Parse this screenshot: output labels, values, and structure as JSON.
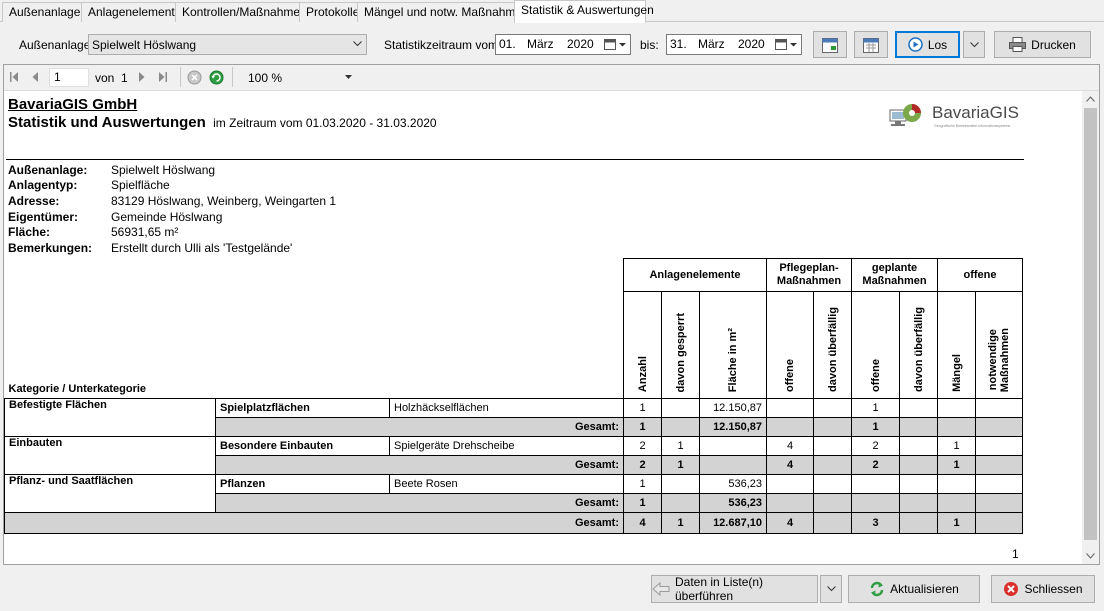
{
  "tabs": [
    "Außenanlagen",
    "Anlagenelemente",
    "Kontrollen/Maßnahmen",
    "Protokolle",
    "Mängel und notw. Maßnahmen",
    "Statistik & Auswertungen"
  ],
  "toolbar": {
    "aussenanlage_label": "Außenanlage:",
    "aussenanlage_value": "Spielwelt Höslwang",
    "zeitraum_label": "Statistikzeitraum vom:",
    "from_day": "01.",
    "from_month": "März",
    "from_year": "2020",
    "bis_label": "bis:",
    "to_day": "31.",
    "to_month": "März",
    "to_year": "2020",
    "los_label": "Los",
    "drucken_label": "Drucken"
  },
  "viewer": {
    "page_value": "1",
    "von_label": "von",
    "page_total": "1",
    "zoom": "100 %",
    "page_number": "1"
  },
  "report": {
    "company": "BavariaGIS GmbH",
    "title": "Statistik und Auswertungen",
    "period": "im Zeitraum vom 01.03.2020 - 31.03.2020",
    "logo_text": "BavariaGIS",
    "logo_sub": "Geografische Betriebsmittel-Informationssysteme",
    "info": [
      {
        "label": "Außenanlage:",
        "value": "Spielwelt Höslwang"
      },
      {
        "label": "Anlagentyp:",
        "value": "Spielfläche"
      },
      {
        "label": "Adresse:",
        "value": "83129 Höslwang, Weinberg, Weingarten 1"
      },
      {
        "label": "Eigentümer:",
        "value": "Gemeinde Höslwang"
      },
      {
        "label": "Fläche:",
        "value": "56931,65 m²"
      },
      {
        "label": "Bemerkungen:",
        "value": "Erstellt durch Ulli als 'Testgelände'"
      }
    ],
    "col_kategorie": "Kategorie / Unterkategorie",
    "groups": {
      "anlagenelemente": "Anlagenelemente",
      "pflegeplan_1": "Pflegeplan-",
      "pflegeplan_2": "Maßnahmen",
      "geplante_1": "geplante",
      "geplante_2": "Maßnahmen",
      "offene": "offene"
    },
    "subheaders": {
      "anzahl": "Anzahl",
      "davon_gesperrt": "davon gesperrt",
      "flaeche": "Fläche in m²",
      "pp_offene": "offene",
      "pp_ueberfaellig": "davon überfällig",
      "gp_offene": "offene",
      "gp_ueberfaellig": "davon überfällig",
      "maengel": "Mängel",
      "notw_1": "notwendige",
      "notw_2": "Maßnahmen"
    },
    "rows": [
      {
        "kategorie": "Befestigte Flächen",
        "unterkategorie": "Spielplatzflächen",
        "element": "Holzhäckselflächen",
        "anzahl": "1",
        "gesperrt": "",
        "flaeche": "12.150,87",
        "pp_offene": "",
        "pp_ueber": "",
        "gp_offene": "1",
        "gp_ueber": "",
        "maengel": "",
        "notw": ""
      },
      {
        "kategorie": "Einbauten",
        "unterkategorie": "Besondere Einbauten",
        "element": "Spielgeräte Drehscheibe",
        "anzahl": "2",
        "gesperrt": "1",
        "flaeche": "",
        "pp_offene": "4",
        "pp_ueber": "",
        "gp_offene": "2",
        "gp_ueber": "",
        "maengel": "1",
        "notw": ""
      },
      {
        "kategorie": "Pflanz- und Saatflächen",
        "unterkategorie": "Pflanzen",
        "element": "Beete Rosen",
        "anzahl": "1",
        "gesperrt": "",
        "flaeche": "536,23",
        "pp_offene": "",
        "pp_ueber": "",
        "gp_offene": "",
        "gp_ueber": "",
        "maengel": "",
        "notw": ""
      }
    ],
    "subtotals": [
      {
        "label": "Gesamt:",
        "anzahl": "1",
        "gesperrt": "",
        "flaeche": "12.150,87",
        "pp_offene": "",
        "pp_ueber": "",
        "gp_offene": "1",
        "gp_ueber": "",
        "maengel": "",
        "notw": ""
      },
      {
        "label": "Gesamt:",
        "anzahl": "2",
        "gesperrt": "1",
        "flaeche": "",
        "pp_offene": "4",
        "pp_ueber": "",
        "gp_offene": "2",
        "gp_ueber": "",
        "maengel": "1",
        "notw": ""
      },
      {
        "label": "Gesamt:",
        "anzahl": "1",
        "gesperrt": "",
        "flaeche": "536,23",
        "pp_offene": "",
        "pp_ueber": "",
        "gp_offene": "",
        "gp_ueber": "",
        "maengel": "",
        "notw": ""
      }
    ],
    "total": {
      "label": "Gesamt:",
      "anzahl": "4",
      "gesperrt": "1",
      "flaeche": "12.687,10",
      "pp_offene": "4",
      "pp_ueber": "",
      "gp_offene": "3",
      "gp_ueber": "",
      "maengel": "1",
      "notw": ""
    }
  },
  "footer": {
    "daten_label": "Daten in Liste(n) überführen",
    "aktualisieren_label": "Aktualisieren",
    "schliessen_label": "Schliessen"
  },
  "colors": {
    "accent": "#0078d7",
    "gray_row": "#d3d3d3",
    "tab_border": "#c8c8c8"
  }
}
